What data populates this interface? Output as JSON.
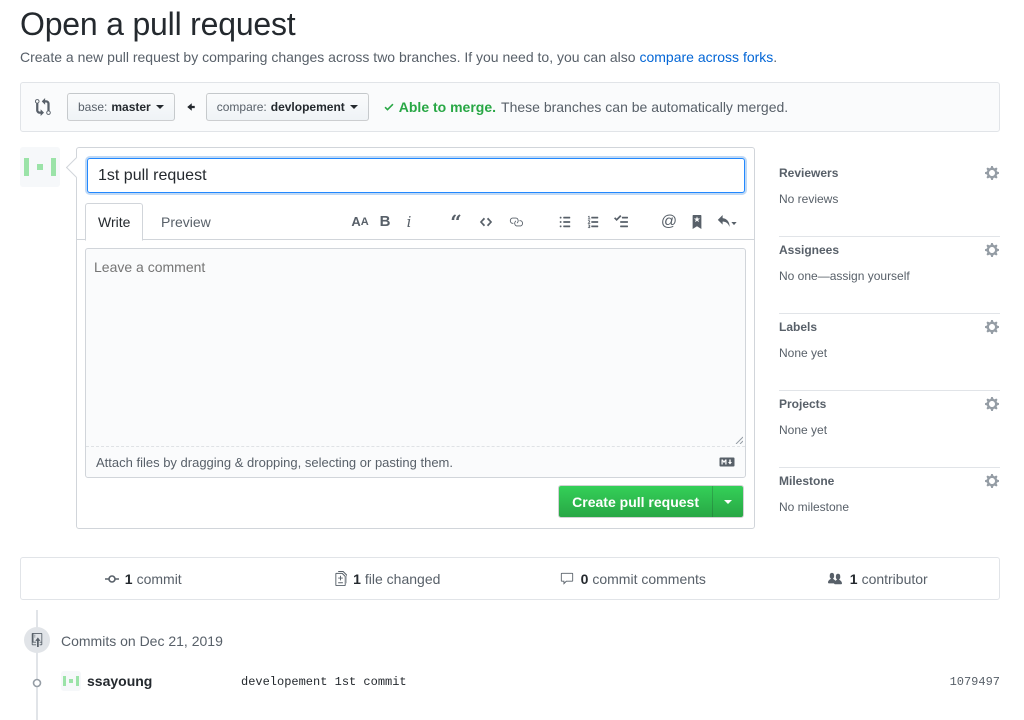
{
  "page": {
    "title": "Open a pull request",
    "subtitle_text": "Create a new pull request by comparing changes across two branches. If you need to, you can also ",
    "subtitle_link": "compare across forks",
    "subtitle_end": "."
  },
  "range": {
    "base_label": "base:",
    "base_value": "master",
    "compare_label": "compare:",
    "compare_value": "devlopement",
    "merge_ok": "Able to merge.",
    "merge_msg": "These branches can be automatically merged."
  },
  "composer": {
    "title_value": "1st pull request",
    "tab_write": "Write",
    "tab_preview": "Preview",
    "comment_placeholder": "Leave a comment",
    "attach_note": "Attach files by dragging & dropping, selecting or pasting them.",
    "submit_label": "Create pull request",
    "toolbar_icons": [
      "text-size-icon",
      "bold-icon",
      "italic-icon",
      "quote-icon",
      "code-icon",
      "link-icon",
      "bullet-list-icon",
      "numbered-list-icon",
      "task-list-icon",
      "mention-icon",
      "bookmark-icon",
      "reply-icon"
    ]
  },
  "sidebar": {
    "items": [
      {
        "heading": "Reviewers",
        "value": "No reviews"
      },
      {
        "heading": "Assignees",
        "value": "No one—assign yourself"
      },
      {
        "heading": "Labels",
        "value": "None yet"
      },
      {
        "heading": "Projects",
        "value": "None yet"
      },
      {
        "heading": "Milestone",
        "value": "No milestone"
      }
    ]
  },
  "stats": {
    "commits_count": "1",
    "commits_label": "commit",
    "files_count": "1",
    "files_label": "file changed",
    "comments_count": "0",
    "comments_label": "commit comments",
    "contributors_count": "1",
    "contributors_label": "contributor"
  },
  "commits": {
    "date_heading": "Commits on Dec 21, 2019",
    "items": [
      {
        "author": "ssayoung",
        "message": "developement 1st commit",
        "sha": "1079497"
      }
    ]
  },
  "colors": {
    "accent": "#0366d6",
    "success": "#28a745",
    "avatar": "#9be3a8"
  }
}
